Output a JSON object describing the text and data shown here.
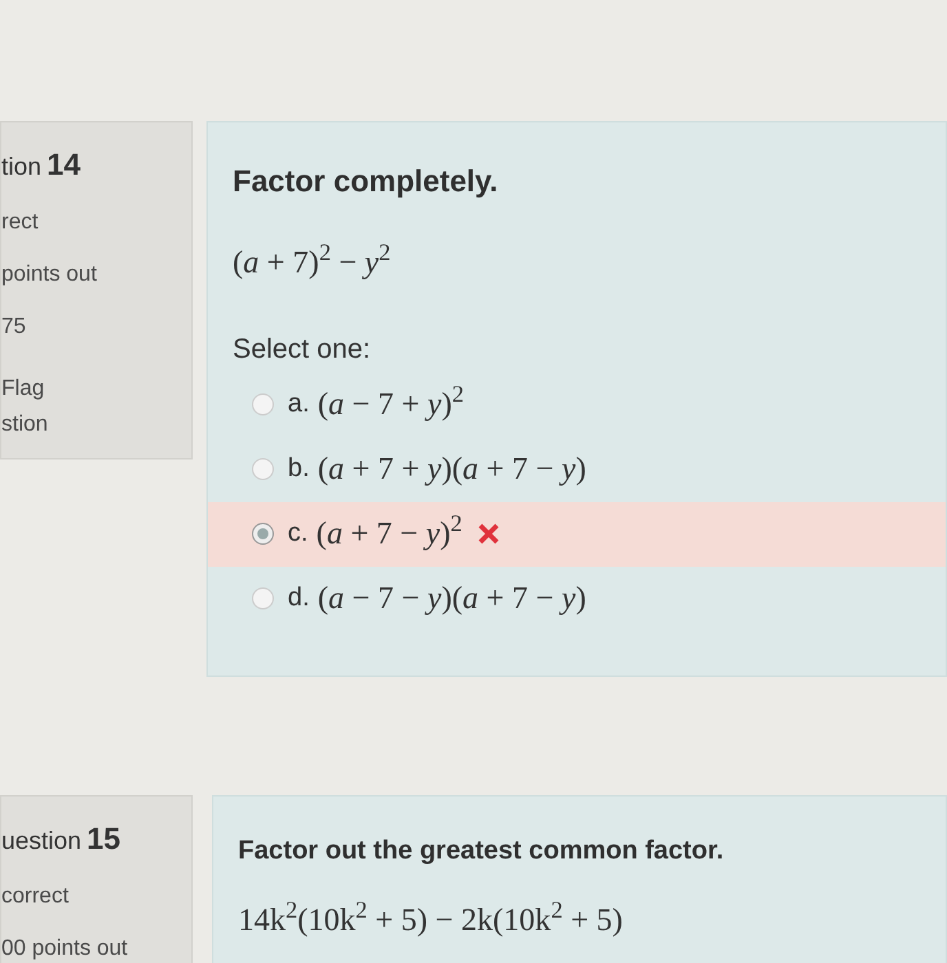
{
  "questions": [
    {
      "info": {
        "label": "tion",
        "number": "14",
        "lines": [
          "rect",
          "points out",
          "75"
        ],
        "flag": [
          "Flag",
          "stion"
        ]
      },
      "prompt": "Factor completely.",
      "expression": "(*a* + 7)$^{2}$ − *y*$^{2}$",
      "select_label": "Select one:",
      "options": [
        {
          "letter": "a.",
          "text": "(*a* − 7 + *y*)$^{2}$",
          "selected": false,
          "incorrect": false
        },
        {
          "letter": "b.",
          "text": "(*a* + 7 + *y*)(*a* + 7 − *y*)",
          "selected": false,
          "incorrect": false
        },
        {
          "letter": "c.",
          "text": "(*a* + 7 − *y*)$^{2}$",
          "selected": true,
          "incorrect": true
        },
        {
          "letter": "d.",
          "text": "(*a* − 7 − *y*)(*a* + 7 − *y*)",
          "selected": false,
          "incorrect": false
        }
      ]
    },
    {
      "info": {
        "label": "uestion",
        "number": "15",
        "lines": [
          "correct",
          "00 points out"
        ]
      },
      "prompt": "Factor out the greatest common factor.",
      "expression": "14k$^{2}$(10k$^{2}$ + 5) − 2k(10k$^{2}$ + 5)"
    }
  ]
}
